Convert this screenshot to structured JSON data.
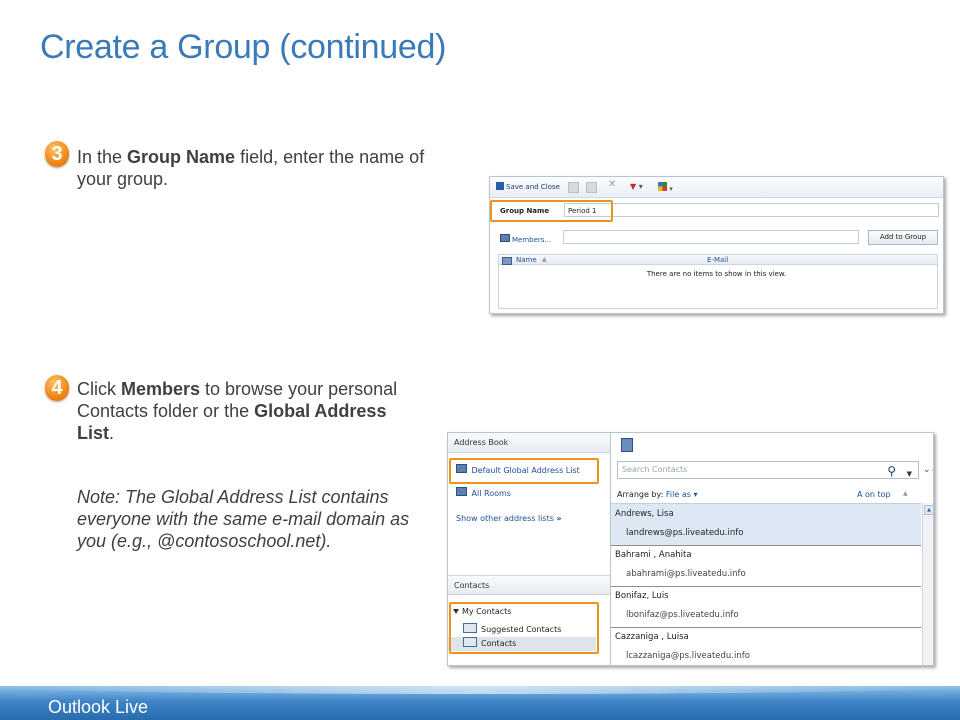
{
  "slide": {
    "title": "Create a Group (continued)",
    "footer": "Outlook Live"
  },
  "step3": {
    "number": "3",
    "text_before": "In the ",
    "bold": "Group Name",
    "text_after": " field, enter the name of your group."
  },
  "step4": {
    "number": "4",
    "text_before": "Click ",
    "bold1": "Members",
    "text_mid": " to browse your personal Contacts folder or the ",
    "bold2": "Global Address List",
    "text_after": ".",
    "note": "Note: The Global Address List contains everyone with the same e-mail domain as you (e.g., @contososchool.net)."
  },
  "group_form": {
    "save_and_close": "Save and Close",
    "group_name_label": "Group Name",
    "group_name_value": "Period 1",
    "members_link": "Members...",
    "add_to_group": "Add to Group",
    "col_name": "Name",
    "col_email": "E-Mail",
    "empty_message": "There are no items to show in this view."
  },
  "address_book": {
    "header": "Address Book",
    "default_gal": "Default Global Address List",
    "all_rooms": "All Rooms",
    "show_other": "Show other address lists",
    "contacts_header": "Contacts",
    "my_contacts": "My Contacts",
    "suggested_contacts": "Suggested Contacts",
    "contacts": "Contacts",
    "search_placeholder": "Search Contacts",
    "arrange_by": "Arrange by:",
    "arrange_value": "File as",
    "a_on_top": "A on top",
    "contact_list": [
      {
        "name": "Andrews, Lisa",
        "email": "landrews@ps.liveatedu.info"
      },
      {
        "name": "Bahrami , Anahita",
        "email": "abahrami@ps.liveatedu.info"
      },
      {
        "name": "Bonifaz, Luis",
        "email": "lbonifaz@ps.liveatedu.info"
      },
      {
        "name": "Cazzaniga , Luisa",
        "email": "lcazzaniga@ps.liveatedu.info"
      }
    ]
  },
  "colors": {
    "title": "#3a7ab8",
    "highlight": "#f0921e",
    "link": "#1a4f9a",
    "footer": "#2a6cae"
  }
}
